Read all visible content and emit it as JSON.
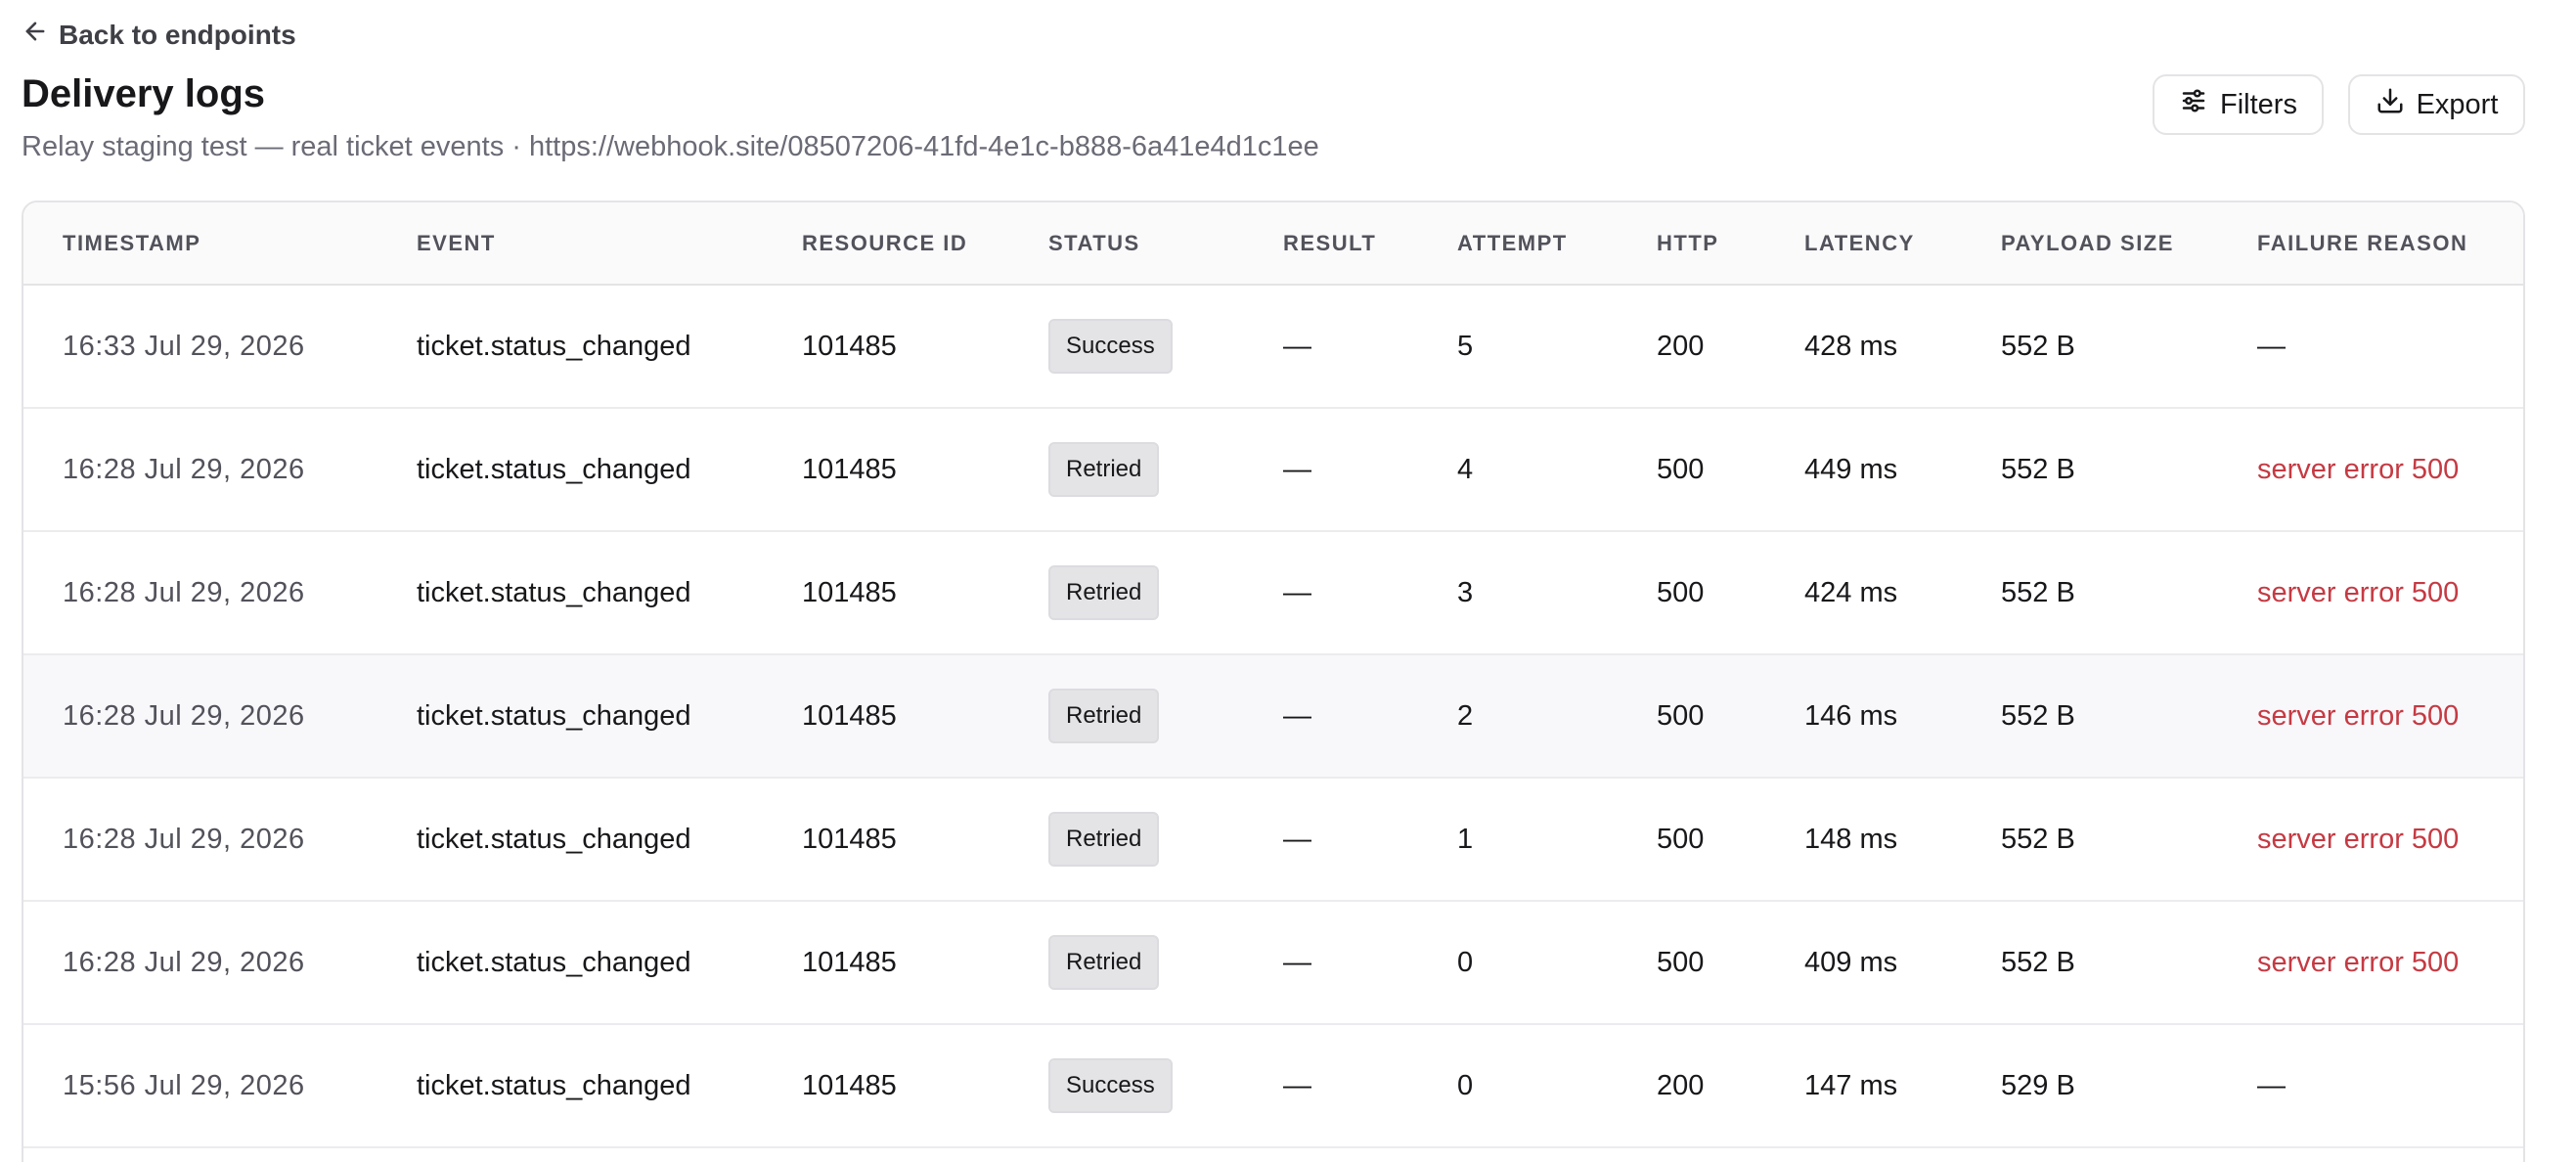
{
  "nav": {
    "back_label": "Back to endpoints"
  },
  "header": {
    "title": "Delivery logs",
    "subtitle": "Relay staging test — real ticket events · https://webhook.site/08507206-41fd-4e1c-b888-6a41e4d1c1ee"
  },
  "toolbar": {
    "filters_label": "Filters",
    "export_label": "Export"
  },
  "colors": {
    "failure_text": "#c53a43",
    "badge_bg": "#e4e4e7"
  },
  "table": {
    "columns": [
      "TIMESTAMP",
      "EVENT",
      "RESOURCE ID",
      "STATUS",
      "RESULT",
      "ATTEMPT",
      "HTTP",
      "LATENCY",
      "PAYLOAD SIZE",
      "FAILURE REASON"
    ],
    "rows": [
      {
        "timestamp": "16:33 Jul 29, 2026",
        "event": "ticket.status_changed",
        "resource_id": "101485",
        "status": "Success",
        "result": "—",
        "attempt": "5",
        "http": "200",
        "latency": "428 ms",
        "payload_size": "552 B",
        "failure_reason": "—"
      },
      {
        "timestamp": "16:28 Jul 29, 2026",
        "event": "ticket.status_changed",
        "resource_id": "101485",
        "status": "Retried",
        "result": "—",
        "attempt": "4",
        "http": "500",
        "latency": "449 ms",
        "payload_size": "552 B",
        "failure_reason": "server error 500"
      },
      {
        "timestamp": "16:28 Jul 29, 2026",
        "event": "ticket.status_changed",
        "resource_id": "101485",
        "status": "Retried",
        "result": "—",
        "attempt": "3",
        "http": "500",
        "latency": "424 ms",
        "payload_size": "552 B",
        "failure_reason": "server error 500"
      },
      {
        "timestamp": "16:28 Jul 29, 2026",
        "event": "ticket.status_changed",
        "resource_id": "101485",
        "status": "Retried",
        "result": "—",
        "attempt": "2",
        "http": "500",
        "latency": "146 ms",
        "payload_size": "552 B",
        "failure_reason": "server error 500"
      },
      {
        "timestamp": "16:28 Jul 29, 2026",
        "event": "ticket.status_changed",
        "resource_id": "101485",
        "status": "Retried",
        "result": "—",
        "attempt": "1",
        "http": "500",
        "latency": "148 ms",
        "payload_size": "552 B",
        "failure_reason": "server error 500"
      },
      {
        "timestamp": "16:28 Jul 29, 2026",
        "event": "ticket.status_changed",
        "resource_id": "101485",
        "status": "Retried",
        "result": "—",
        "attempt": "0",
        "http": "500",
        "latency": "409 ms",
        "payload_size": "552 B",
        "failure_reason": "server error 500"
      },
      {
        "timestamp": "15:56 Jul 29, 2026",
        "event": "ticket.status_changed",
        "resource_id": "101485",
        "status": "Success",
        "result": "—",
        "attempt": "0",
        "http": "200",
        "latency": "147 ms",
        "payload_size": "529 B",
        "failure_reason": "—"
      }
    ]
  }
}
